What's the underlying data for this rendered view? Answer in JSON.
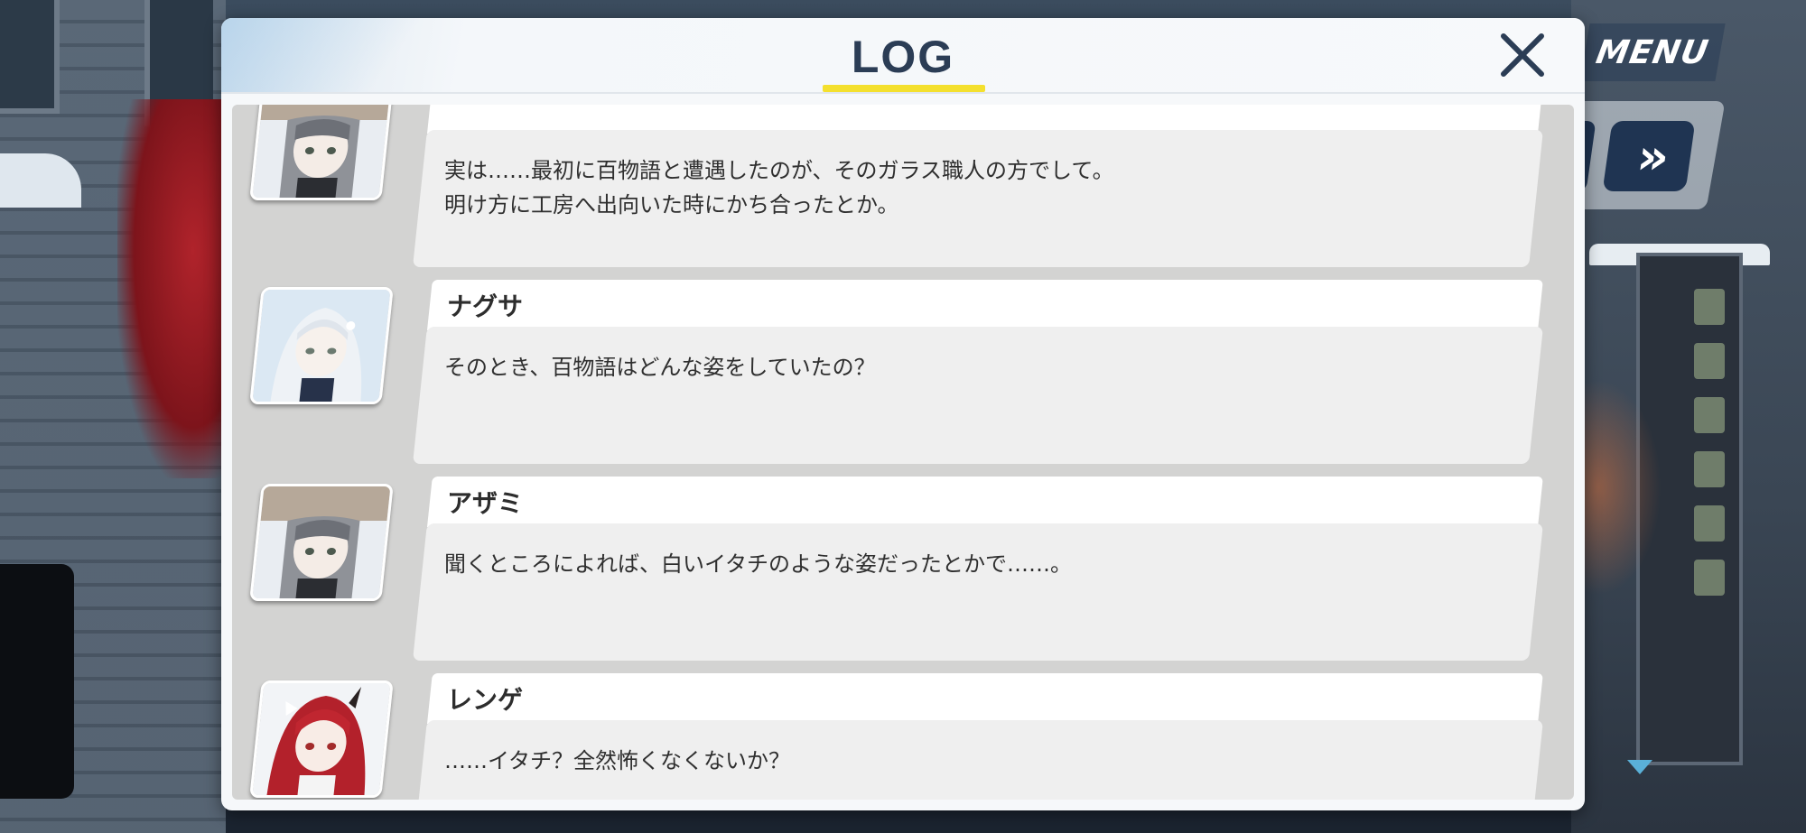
{
  "hud": {
    "menu_label": "MENU",
    "skip_label": "»"
  },
  "log": {
    "title": "LOG",
    "close_label": "✕",
    "entries": [
      {
        "speaker": "",
        "portrait": "azami-portrait",
        "text": "実は……最初に百物語と遭遇したのが、そのガラス職人の方でして。\n明け方に工房へ出向いた時にかち合ったとか。"
      },
      {
        "speaker": "ナグサ",
        "portrait": "nagusa-portrait",
        "text": "そのとき、百物語はどんな姿をしていたの？"
      },
      {
        "speaker": "アザミ",
        "portrait": "azami-portrait",
        "text": "聞くところによれば、白いイタチのような姿だったとかで……。"
      },
      {
        "speaker": "レンゲ",
        "portrait": "renge-portrait",
        "text": "……イタチ？全然怖くなくないか？"
      }
    ]
  },
  "colors": {
    "title": "#2b3d55",
    "underline": "#f4e02e",
    "button_navy": "#1f3452"
  }
}
